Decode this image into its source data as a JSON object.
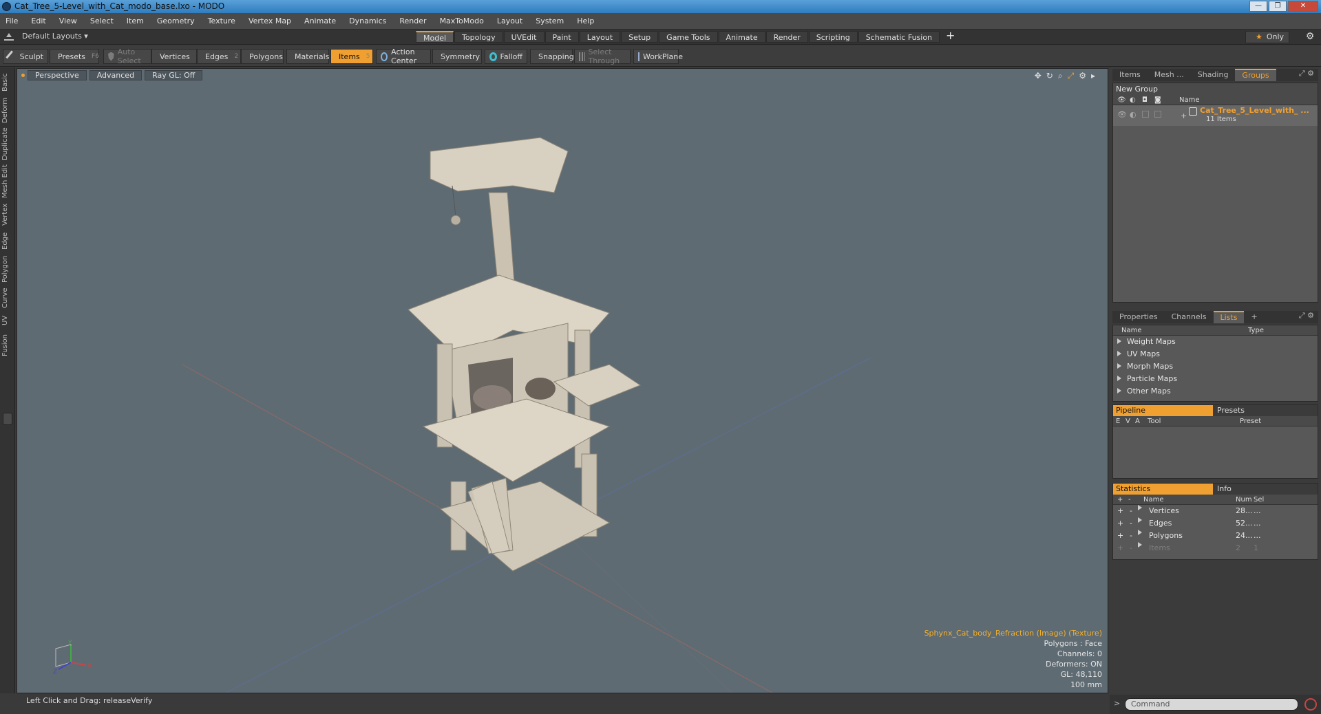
{
  "window": {
    "title": "Cat_Tree_5-Level_with_Cat_modo_base.lxo - MODO",
    "min": "—",
    "max": "❐",
    "close": "✕"
  },
  "menu": [
    "File",
    "Edit",
    "View",
    "Select",
    "Item",
    "Geometry",
    "Texture",
    "Vertex Map",
    "Animate",
    "Dynamics",
    "Render",
    "MaxToModo",
    "Layout",
    "System",
    "Help"
  ],
  "layout": {
    "current": "Default Layouts ▾",
    "tabs": [
      "Model",
      "Topology",
      "UVEdit",
      "Paint",
      "Layout",
      "Setup",
      "Game Tools",
      "Animate",
      "Render",
      "Scripting",
      "Schematic Fusion"
    ],
    "active_tab": "Model",
    "plus": "+",
    "only_label": "Only",
    "star": "★",
    "gear": "⚙"
  },
  "toolbar": {
    "sculpt": "Sculpt",
    "presets": "Presets",
    "presets_key": "F6",
    "auto_select": "Auto Select",
    "vertices": "Vertices",
    "vertices_key": "1",
    "edges": "Edges",
    "edges_key": "2",
    "polygons": "Polygons",
    "materials": "Materials",
    "items": "Items",
    "items_key": "5",
    "action_center": "Action Center",
    "symmetry": "Symmetry",
    "falloff": "Falloff",
    "snapping": "Snapping",
    "select_through": "Select Through",
    "workplane": "WorkPlane"
  },
  "left_tabs": [
    "Basic",
    "Deform",
    "Duplicate",
    "Mesh Edit",
    "Vertex",
    "Edge",
    "Polygon",
    "Curve",
    "UV",
    "Fusion"
  ],
  "viewport": {
    "view": "Perspective",
    "shading": "Advanced",
    "raygl": "Ray GL: Off",
    "info": {
      "texture": "Sphynx_Cat_body_Refraction (Image) (Texture)",
      "polygons": "Polygons : Face",
      "channels": "Channels: 0",
      "deformers": "Deformers: ON",
      "gl": "GL: 48,110",
      "scale": "100 mm"
    },
    "axis": {
      "x": "X",
      "y": "Y",
      "z": "Z"
    }
  },
  "status": {
    "hint": "Left Click and Drag:   releaseVerify"
  },
  "items_panel": {
    "tabs": [
      "Items",
      "Mesh ...",
      "Shading",
      "Groups"
    ],
    "active_tab": "Groups",
    "new_group": "New Group",
    "column_name": "Name",
    "group": {
      "name": "Cat_Tree_5_Level_with_ ...",
      "count": "11 Items"
    }
  },
  "lists_panel": {
    "tabs": [
      "Properties",
      "Channels",
      "Lists"
    ],
    "active_tab": "Lists",
    "plus": "+",
    "columns": [
      "Name",
      "Type"
    ],
    "rows": [
      "Weight Maps",
      "UV Maps",
      "Morph Maps",
      "Particle Maps",
      "Other Maps"
    ]
  },
  "pipeline_panel": {
    "tabs": [
      "Pipeline",
      "Presets"
    ],
    "columns": [
      "E",
      "V",
      "A",
      "Tool",
      "Preset"
    ]
  },
  "stats_panel": {
    "tabs": [
      "Statistics",
      "Info"
    ],
    "columns": [
      "+",
      "-",
      "Name",
      "Num",
      "Sel"
    ],
    "rows": [
      {
        "name": "Vertices",
        "num": "28...",
        "sel": "..."
      },
      {
        "name": "Edges",
        "num": "52...",
        "sel": "..."
      },
      {
        "name": "Polygons",
        "num": "24...",
        "sel": "..."
      },
      {
        "name": "Items",
        "num": "2",
        "sel": "1"
      }
    ]
  },
  "command": {
    "prompt": ">",
    "placeholder": "Command"
  },
  "colors": {
    "accent": "#f0a030",
    "viewport_bg": "#5f6b73",
    "panel_bg": "#3b3b3b"
  }
}
